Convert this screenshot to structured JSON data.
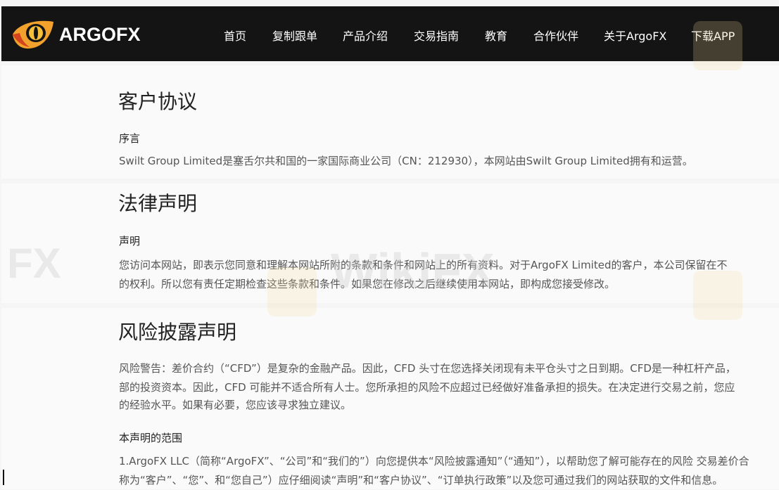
{
  "brand": {
    "name": "ARGOFX",
    "accent": "#f2a22c",
    "dark_accent": "#d2451e"
  },
  "nav": {
    "items": [
      {
        "label": "首页"
      },
      {
        "label": "复制跟单"
      },
      {
        "label": "产品介绍"
      },
      {
        "label": "交易指南"
      },
      {
        "label": "教育"
      },
      {
        "label": "合作伙伴"
      },
      {
        "label": "关于ArgoFX"
      },
      {
        "label": "下载APP"
      }
    ]
  },
  "sections": {
    "agreement": {
      "title": "客户协议",
      "subtitle": "序言",
      "text": "Swilt Group Limited是塞舌尔共和国的一家国际商业公司（CN：212930），本网站由Swilt Group Limited拥有和运营。"
    },
    "legal": {
      "title": "法律声明",
      "subtitle": "声明",
      "lines": [
        "您访问本网站，即表示您同意和理解本网站所附的条款和条件和网站上的所有资料。对于ArgoFX Limited的客户，本公司保留在不",
        "的权利。所以您有责任定期检查这些条款和条件。如果您在修改之后继续使用本网站，即构成您接受修改。"
      ]
    },
    "risk": {
      "title": "风险披露声明",
      "lines": [
        "风险警告：差价合约（“CFD”）是复杂的金融产品。因此，CFD 头寸在您选择关闭现有未平仓头寸之日到期。CFD是一种杠杆产品，",
        "部的投资资本。因此，CFD 可能并不适合所有人士。您所承担的风险不应超过已经做好准备承担的损失。在决定进行交易之前，您应",
        "的经验水平。如果有必要，您应该寻求独立建议。"
      ],
      "scope_title": "本声明的范围",
      "scope_lines": [
        "1.ArgoFX LLC（简称“ArgoFX”、“公司”和“我们的”）向您提供本“风险披露通知”（“通知”），以帮助您了解可能存在的风险 交易差价合",
        "称为“客户”、“您”、和“您自己”）应仔细阅读“声明”和“客户协议”、“订单执行政策”以及您可通过我们的网站获取的文件和信息。"
      ]
    }
  },
  "watermark": {
    "text": "FX",
    "text2": "WikiFX"
  }
}
